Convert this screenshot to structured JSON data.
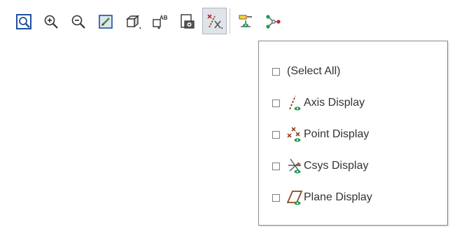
{
  "colors": {
    "toolbar_active_bg": "#e0e4ea",
    "icon_blue": "#1f4fa0",
    "icon_green": "#1f9b55",
    "icon_red": "#c0262e",
    "icon_brown": "#8b4a26",
    "text": "#333333"
  },
  "toolbar": {
    "buttons": [
      {
        "icon": "zoom-fit-icon"
      },
      {
        "icon": "zoom-in-icon"
      },
      {
        "icon": "zoom-out-icon"
      },
      {
        "icon": "repaint-icon"
      },
      {
        "icon": "view-cube-icon"
      },
      {
        "icon": "annotation-display-icon"
      },
      {
        "icon": "snapshot-icon"
      },
      {
        "icon": "datum-display-icon",
        "active": true
      },
      {
        "icon": "datum-plane-tag-icon"
      },
      {
        "icon": "network-display-icon"
      }
    ]
  },
  "datum_menu": {
    "items": [
      {
        "label": "(Select All)",
        "checked": false,
        "icon": ""
      },
      {
        "label": "Axis Display",
        "checked": false,
        "icon": "axis-display-icon"
      },
      {
        "label": "Point Display",
        "checked": false,
        "icon": "point-display-icon"
      },
      {
        "label": "Csys Display",
        "checked": false,
        "icon": "csys-display-icon"
      },
      {
        "label": "Plane Display",
        "checked": false,
        "icon": "plane-display-icon"
      }
    ]
  }
}
